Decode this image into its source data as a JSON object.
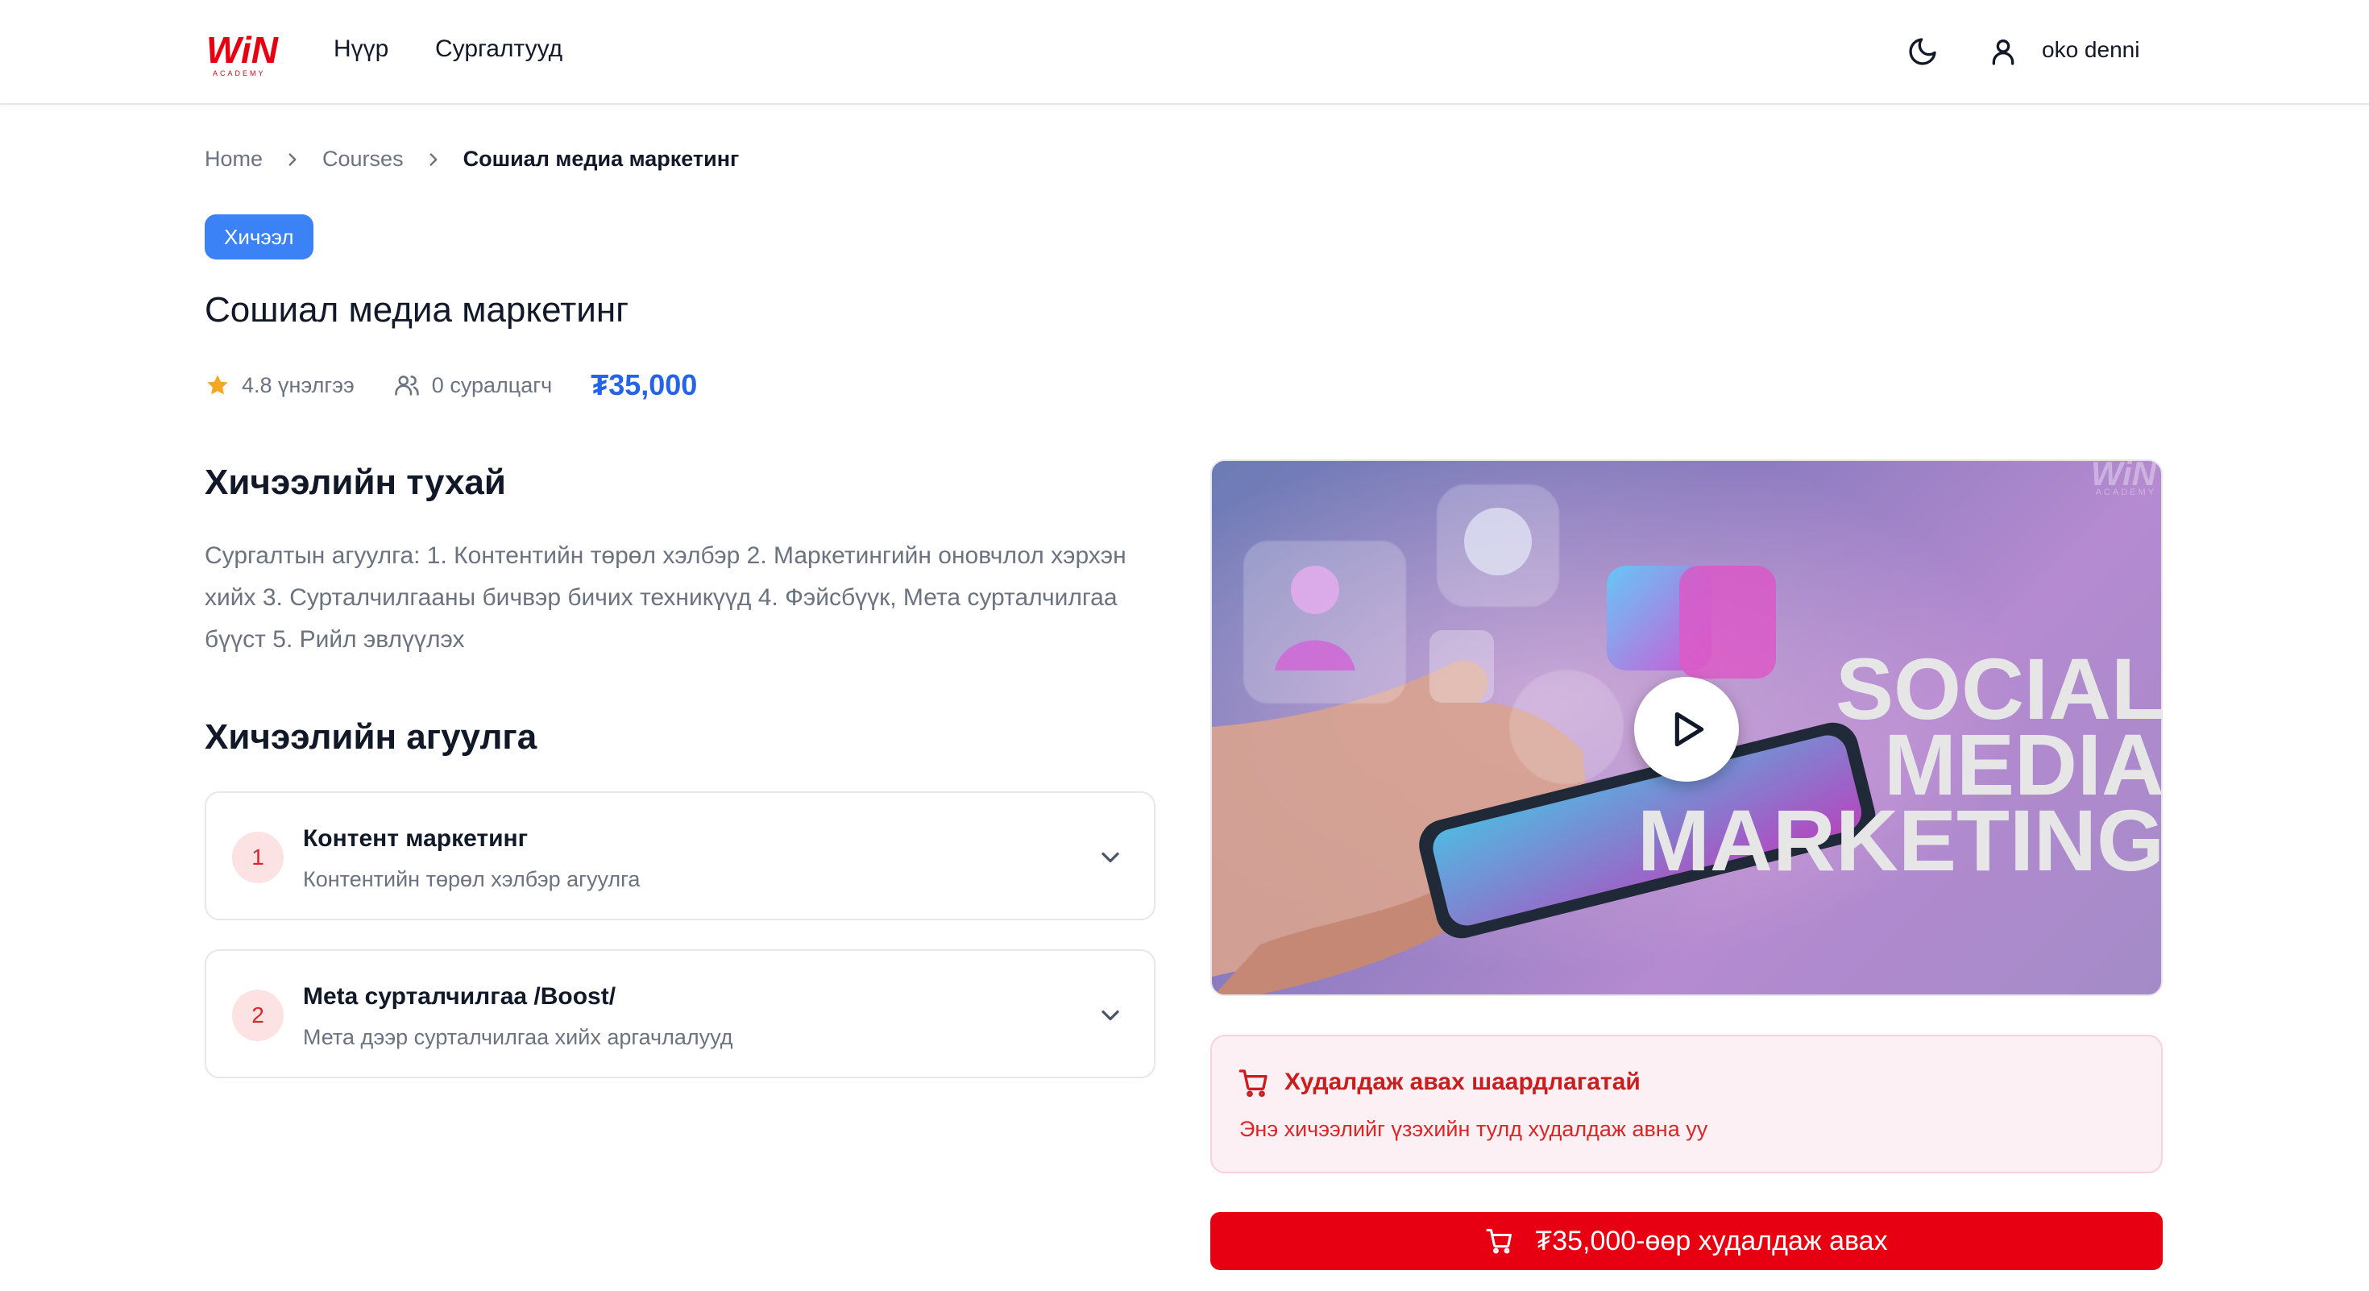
{
  "header": {
    "logo_text": "WiN",
    "logo_sub": "ACADEMY",
    "nav": [
      {
        "label": "Нүүр"
      },
      {
        "label": "Сургалтууд"
      }
    ],
    "user_name": "oko denni"
  },
  "breadcrumb": {
    "home": "Home",
    "courses": "Courses",
    "current": "Сошиал медиа маркетинг"
  },
  "course": {
    "badge": "Хичээл",
    "title": "Сошиал медиа маркетинг",
    "rating": "4.8 үнэлгээ",
    "students": "0 суралцагч",
    "price": "₮35,000"
  },
  "about": {
    "heading": "Хичээлийн тухай",
    "text": "Сургалтын агуулга: 1. Контентийн төрөл хэлбэр 2. Маркетингийн оновчлол хэрхэн хийх 3. Сурталчилгааны бичвэр бичих техникүүд 4. Фэйсбүүк, Мета сурталчилгаа бүүст 5. Рийл эвлүүлэх"
  },
  "content": {
    "heading": "Хичээлийн агуулга",
    "lessons": [
      {
        "num": "1",
        "title": "Контент маркетинг",
        "subtitle": "Контентийн төрөл хэлбэр агуулга"
      },
      {
        "num": "2",
        "title": "Meta сурталчилгаа /Boost/",
        "subtitle": "Мета дээр сурталчилгаа хийх аргачлалууд"
      }
    ]
  },
  "video": {
    "line1": "SOCIAL",
    "line2": "MEDIA",
    "line3": "MARKETING",
    "watermark": "WiN",
    "watermark_sub": "ACADEMY"
  },
  "purchase": {
    "alert_title": "Худалдаж авах шаардлагатай",
    "alert_text": "Энэ хичээлийг үзэхийн тулд худалдаж авна уу",
    "button_label": "₮35,000-өөр худалдаж авах"
  },
  "colors": {
    "accent_blue": "#2563eb",
    "badge_blue": "#3b82f6",
    "brand_red": "#e60012",
    "star": "#f5a623"
  }
}
